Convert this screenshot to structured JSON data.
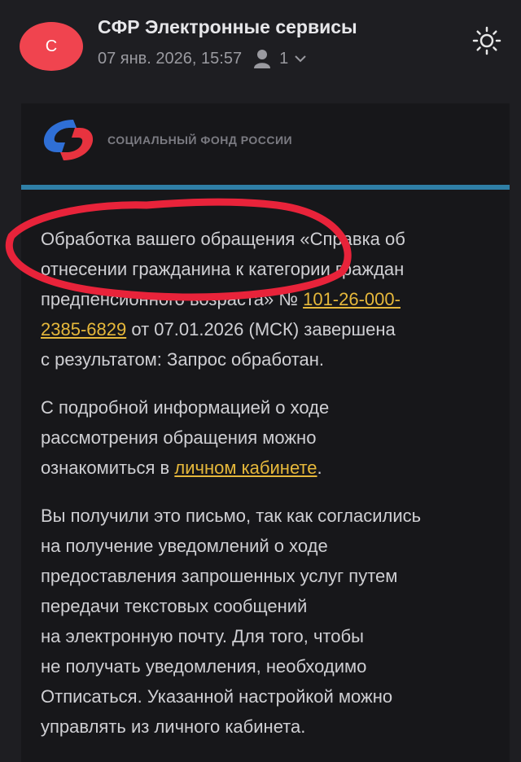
{
  "header": {
    "avatar_letter": "С",
    "sender": "СФР Электронные сервисы",
    "date": "07 янв. 2026, 15:57",
    "recipients_count": "1"
  },
  "email": {
    "logo_text": "СОЦИАЛЬНЫЙ ФОНД РОССИИ",
    "p1": {
      "l1": "Обработка вашего обращения «Справка об",
      "l2": "отнесении гражданина к категории граждан",
      "l3_text": "предпенсионного возраста» № ",
      "link_part1": "101-26-000-",
      "link_part2": "2385-6829",
      "l4_rest": " от 07.01.2026 (МСК) завершена",
      "l5": "с результатом: Запрос обработан."
    },
    "p2": {
      "l1": "С подробной информацией о ходе",
      "l2": "рассмотрения обращения можно",
      "l3_text": "ознакомиться в ",
      "link": "личном кабинете",
      "l3_end": "."
    },
    "p3": {
      "l1": "Вы получили это письмо, так как согласились",
      "l2": "на получение уведомлений о ходе",
      "l3": "предоставления запрошенных услуг путем",
      "l4": "передачи текстовых сообщений",
      "l5": "на электронную почту. Для того, чтобы",
      "l6": "не получать уведомления, необходимо",
      "l7": "Отписаться. Указанной настройкой можно",
      "l8": "управлять из личного кабинета."
    }
  },
  "colors": {
    "background": "#1e1e22",
    "avatar": "#f0444f",
    "link": "#e6b83b",
    "rule": "#2f7fa6",
    "annotation": "#e8233a"
  },
  "icons": [
    "person-icon",
    "chevron-down-icon",
    "sun-icon",
    "sfr-logo"
  ]
}
